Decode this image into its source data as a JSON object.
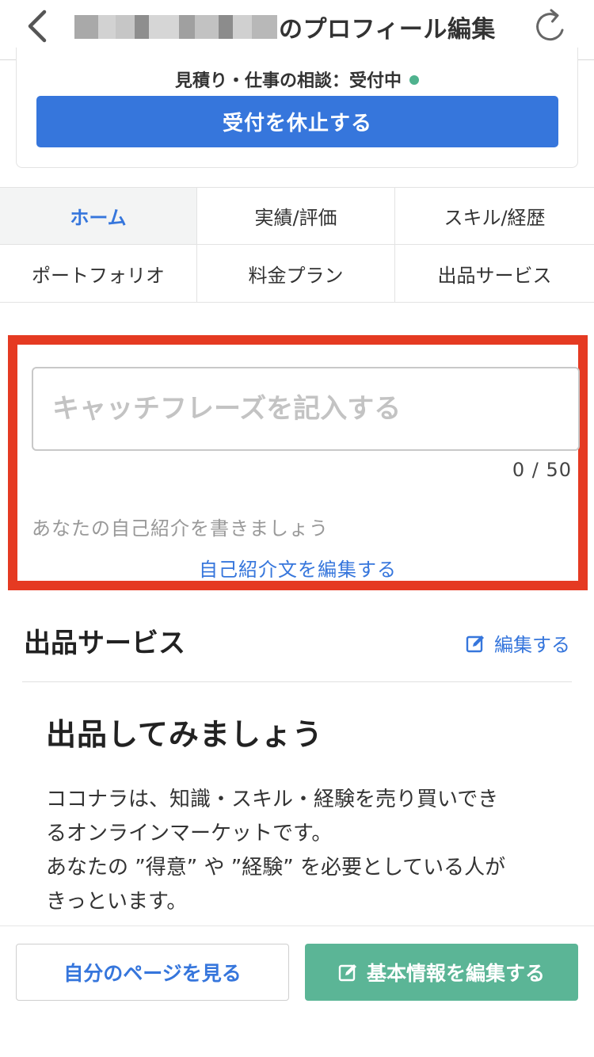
{
  "header": {
    "title": "のプロフィール編集",
    "back_icon": "chevron-left-icon",
    "refresh_icon": "refresh-icon"
  },
  "status": {
    "text": "見積り・仕事の相談：受付中",
    "indicator_color": "#4fb28e",
    "pause_button": "受付を休止する"
  },
  "tabs": [
    {
      "label": "ホーム",
      "active": true
    },
    {
      "label": "実績/評価"
    },
    {
      "label": "スキル/経歴"
    },
    {
      "label": "ポートフォリオ"
    },
    {
      "label": "料金プラン"
    },
    {
      "label": "出品サービス"
    }
  ],
  "catchphrase": {
    "placeholder": "キャッチフレーズを記入する",
    "value": "",
    "count": "0 / 50"
  },
  "intro": {
    "placeholder": "あなたの自己紹介を書きましょう",
    "edit_link": "自己紹介文を編集する"
  },
  "services_section": {
    "title": "出品サービス",
    "edit_label": "編集する",
    "empty_title": "出品してみましょう",
    "description_lines": [
      "ココナラは、知識・スキル・経験を売り買いでき",
      "るオンラインマーケットです。",
      "あなたの ”得意” や ”経験” を必要としている人が",
      "きっといます。"
    ]
  },
  "bottom_bar": {
    "my_page_button": "自分のページを見る",
    "edit_basic_button": "基本情報を編集する"
  },
  "colors": {
    "accent_blue": "#3676dc",
    "accent_green": "#5bb596",
    "highlight_red": "#e53a22"
  }
}
